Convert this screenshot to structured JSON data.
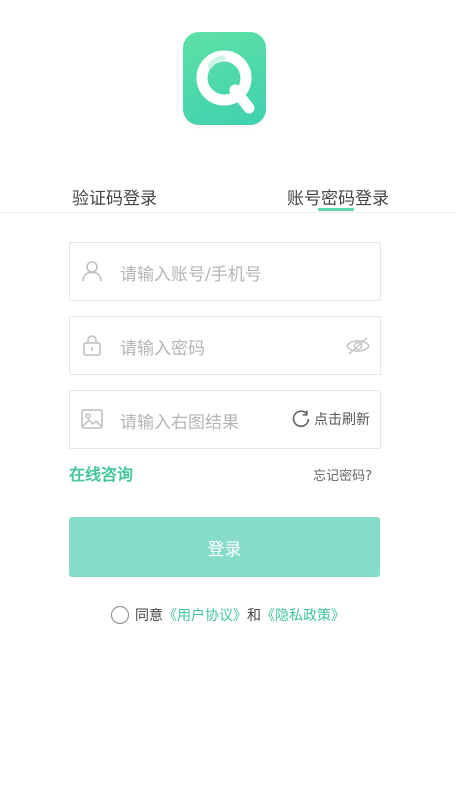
{
  "tabs": {
    "code_login": "验证码登录",
    "password_login": "账号密码登录"
  },
  "fields": {
    "account_placeholder": "请输入账号/手机号",
    "password_placeholder": "请输入密码",
    "captcha_placeholder": "请输入右图结果",
    "refresh_label": "点击刷新"
  },
  "links": {
    "consult": "在线咨询",
    "forgot": "忘记密码?"
  },
  "login_button": "登录",
  "agreement": {
    "prefix": "同意",
    "user_agreement": "《用户协议》",
    "and": "和",
    "privacy_policy": "《隐私政策》"
  },
  "colors": {
    "accent": "#44c59c",
    "button": "#86dcc8"
  }
}
